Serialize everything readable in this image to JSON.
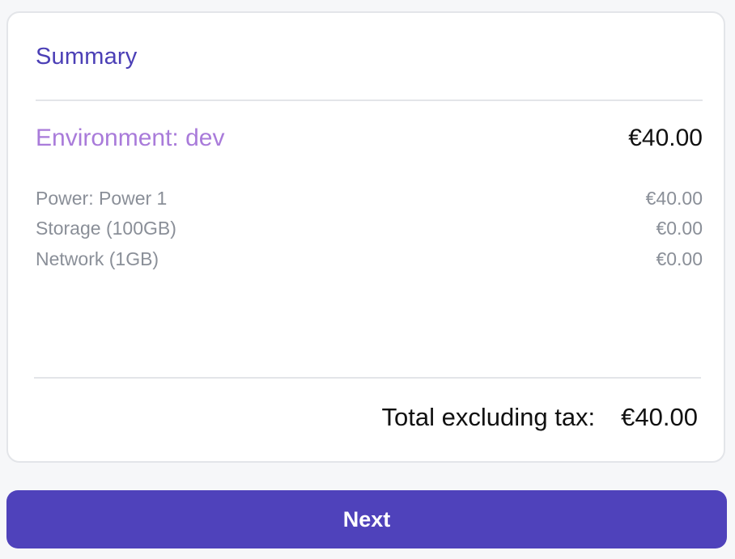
{
  "summary": {
    "title": "Summary",
    "environment": {
      "label": "Environment: dev",
      "price": "€40.00"
    },
    "line_items": [
      {
        "name": "Power: Power 1",
        "price": "€40.00"
      },
      {
        "name": "Storage (100GB)",
        "price": "€0.00"
      },
      {
        "name": "Network (1GB)",
        "price": "€0.00"
      }
    ],
    "total": {
      "label": "Total excluding tax:",
      "value": "€40.00"
    }
  },
  "actions": {
    "next_label": "Next"
  },
  "colors": {
    "accent": "#4f42bb",
    "title": "#4b3fb6",
    "environment": "#a97bda",
    "muted_text": "#8a8f98"
  }
}
